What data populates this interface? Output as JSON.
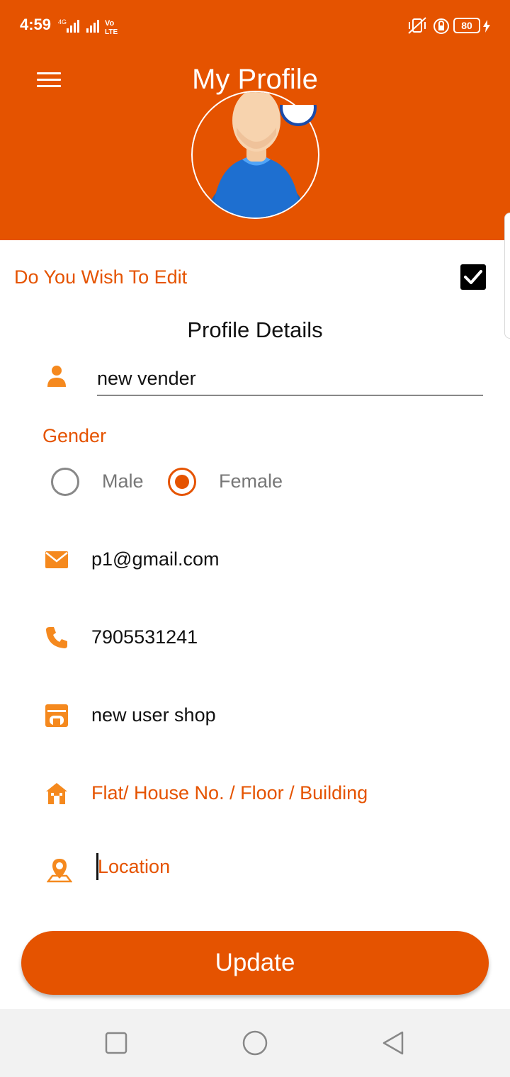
{
  "status_bar": {
    "time": "4:59",
    "network_label": "4G",
    "volte_label": "Vo LTE",
    "battery_level": "80"
  },
  "header": {
    "title": "My Profile",
    "menu_icon": "hamburger-menu-icon",
    "avatar": "default-male-avatar",
    "background_color": "#E55300"
  },
  "edit_toggle": {
    "label": "Do You Wish To Edit",
    "checked": true
  },
  "section_title": "Profile Details",
  "fields": {
    "name": {
      "icon": "person-icon",
      "value": "new vender"
    },
    "gender": {
      "label": "Gender",
      "options": [
        {
          "label": "Male",
          "selected": false
        },
        {
          "label": "Female",
          "selected": true
        }
      ]
    },
    "email": {
      "icon": "mail-icon",
      "value": "p1@gmail.com"
    },
    "phone": {
      "icon": "phone-icon",
      "value": "7905531241"
    },
    "shop": {
      "icon": "store-icon",
      "value": "new user shop"
    },
    "address": {
      "icon": "house-icon",
      "placeholder": "Flat/ House No. / Floor / Building"
    },
    "location": {
      "icon": "location-pin-icon",
      "placeholder": "Location"
    }
  },
  "update_button": {
    "label": "Update"
  },
  "nav_bar": {
    "recent_icon": "square-icon",
    "home_icon": "circle-icon",
    "back_icon": "triangle-back-icon"
  },
  "colors": {
    "accent": "#E55300",
    "icon_orange": "#F5891E"
  }
}
